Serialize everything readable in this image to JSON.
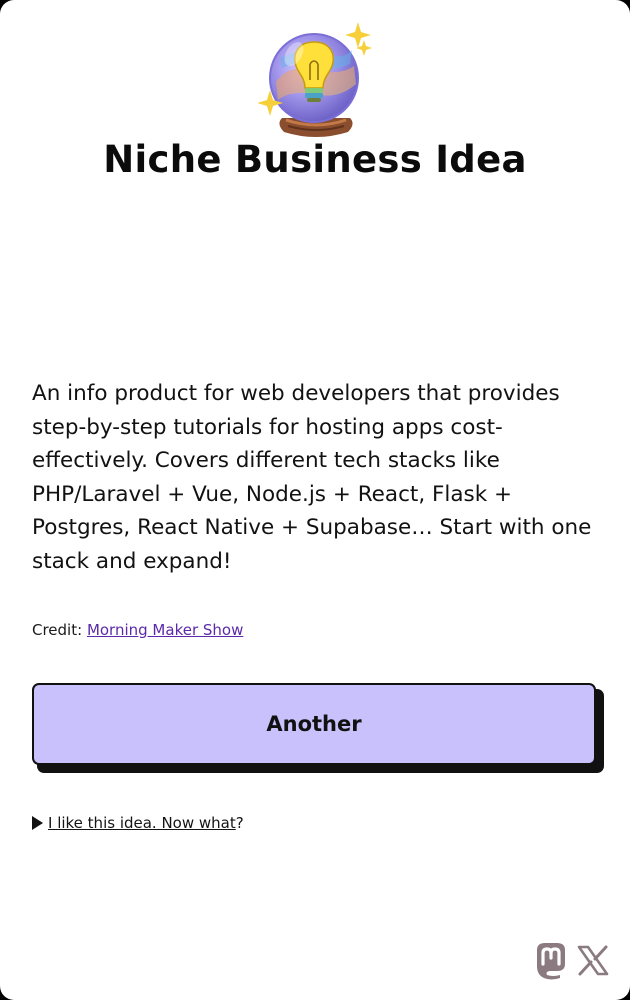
{
  "logo": {
    "icon": "crystal-ball-lightbulb-icon"
  },
  "page": {
    "title": "Niche Business Idea",
    "idea_text": "An info product for web developers that provides step-by-step tutorials for hosting apps cost-effectively. Covers different tech stacks like PHP/Laravel + Vue, Node.js + React, Flask + Postgres, React Native + Supabase… Start with one stack and expand!"
  },
  "credit": {
    "prefix": "Credit: ",
    "link_text": "Morning Maker Show",
    "link_color": "#5b2aa8"
  },
  "button": {
    "label": "Another",
    "background": "#c9c1fb"
  },
  "details": {
    "summary_link": "I like this idea. Now what",
    "summary_suffix": "?"
  },
  "social": {
    "icons": [
      "mastodon-icon",
      "x-icon"
    ],
    "color": "#8b7a80"
  }
}
